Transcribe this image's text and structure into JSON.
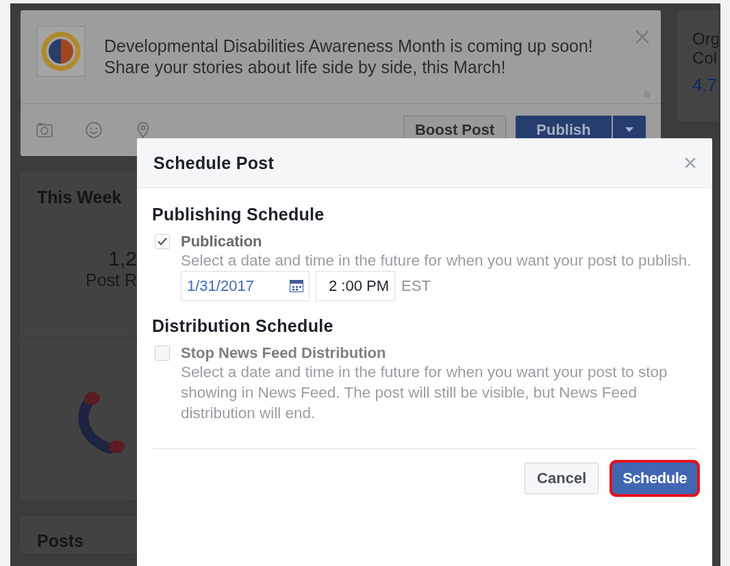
{
  "composer": {
    "banner_lines": [
      "Developmental Disabilities Awareness Month is coming up soon!",
      "Share your stories about life side by side, this March!"
    ],
    "boost": "Boost Post",
    "publish": "Publish"
  },
  "left_cards": [
    {
      "title": "This Week",
      "value": "1,2",
      "label": "Post R"
    },
    {
      "title": "Posts"
    }
  ],
  "right_card": {
    "lines": [
      "Org",
      "Col"
    ],
    "value": "4.7"
  },
  "dialog": {
    "title": "Schedule Post",
    "sections": [
      {
        "heading": "Publishing Schedule",
        "label": "Publication",
        "checked": true,
        "description": "Select a date and time in the future for when you want your post to publish.",
        "date": "1/31/2017",
        "time": "2 :00 PM",
        "timezone": "EST"
      },
      {
        "heading": "Distribution Schedule",
        "label": "Stop News Feed Distribution",
        "checked": false,
        "description": "Select a date and time in the future for when you want your post to stop showing in News Feed. The post will still be visible, but News Feed distribution will end."
      }
    ],
    "buttons": [
      {
        "label": "Cancel",
        "kind": "secondary",
        "highlighted": false
      },
      {
        "label": "Schedule",
        "kind": "primary",
        "highlighted": true
      }
    ]
  }
}
